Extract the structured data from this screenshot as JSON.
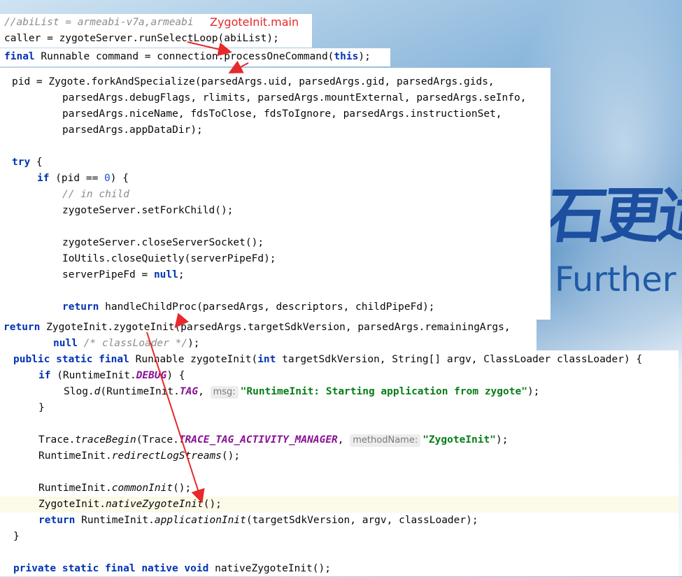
{
  "background": {
    "cjk_text": "石更适",
    "further_text": "Further"
  },
  "annotation": {
    "label": "ZygoteInit.main",
    "color": "#e8282a"
  },
  "snippet1": {
    "line1_comment": "//abiList = armeabi-v7a,armeabi",
    "line2": "caller = zygoteServer.runSelectLoop(abiList);"
  },
  "snippet2": {
    "kw_final": "final",
    "rest": " Runnable command = connection.processOneCommand(",
    "kw_this": "this",
    "end": ");"
  },
  "snippet3": {
    "l1": "pid = Zygote.forkAndSpecialize(parsedArgs.uid, parsedArgs.gid, parsedArgs.gids,",
    "l2": "parsedArgs.debugFlags, rlimits, parsedArgs.mountExternal, parsedArgs.seInfo,",
    "l3": "parsedArgs.niceName, fdsToClose, fdsToIgnore, parsedArgs.instructionSet,",
    "l4": "parsedArgs.appDataDir);",
    "kw_try": "try",
    "try_rest": " {",
    "kw_if": "if",
    "if_a": " (pid == ",
    "if_num": "0",
    "if_b": ") {",
    "comment_child": "// in child",
    "l_setfork": "zygoteServer.setForkChild();",
    "l_close": "zygoteServer.closeServerSocket();",
    "l_ioutils": "IoUtils.closeQuietly(serverPipeFd);",
    "l_pipe_a": "serverPipeFd = ",
    "kw_null": "null",
    "l_pipe_b": ";",
    "kw_return": "return",
    "l_return_rest": " handleChildProc(parsedArgs, descriptors, childPipeFd);"
  },
  "snippet4": {
    "kw_return": "return",
    "l1_rest": " ZygoteInit.zygoteInit(parsedArgs.targetSdkVersion, parsedArgs.remainingArgs,",
    "kw_null": "null",
    "comment": " /* classLoader */",
    "l2_end": ");"
  },
  "snippet5": {
    "kw_public": "public static final",
    "sig_a": " Runnable zygoteInit(",
    "kw_int": "int",
    "sig_b": " targetSdkVersion, String[] argv, ClassLoader classLoader) {",
    "kw_if": "if",
    "if_a": " (RuntimeInit.",
    "const_debug": "DEBUG",
    "if_b": ") {",
    "slog_a": "Slog.",
    "slog_d": "d",
    "slog_b": "(RuntimeInit.",
    "const_tag": "TAG",
    "slog_c": ", ",
    "hint_msg": "msg:",
    "str_starting": "\"RuntimeInit: Starting application from zygote\"",
    "slog_end": ");",
    "close_brace": "}",
    "trace_a": "Trace.",
    "trace_m": "traceBegin",
    "trace_b": "(Trace.",
    "const_trace": "TRACE_TAG_ACTIVITY_MANAGER",
    "trace_c": ", ",
    "hint_method": "methodName:",
    "str_zygote": "\"ZygoteInit\"",
    "trace_end": ");",
    "redir_a": "RuntimeInit.",
    "redir_m": "redirectLogStreams",
    "redir_b": "();",
    "common_a": "RuntimeInit.",
    "common_m": "commonInit",
    "common_b": "();",
    "native_a": "ZygoteInit.",
    "native_m": "nativeZygoteInit",
    "native_b": "();",
    "kw_return": "return",
    "ret_a": " RuntimeInit.",
    "ret_m": "applicationInit",
    "ret_b": "(targetSdkVersion, argv, classLoader);",
    "end_brace": "}",
    "kw_private": "private static final native void",
    "private_rest": " nativeZygoteInit();"
  }
}
